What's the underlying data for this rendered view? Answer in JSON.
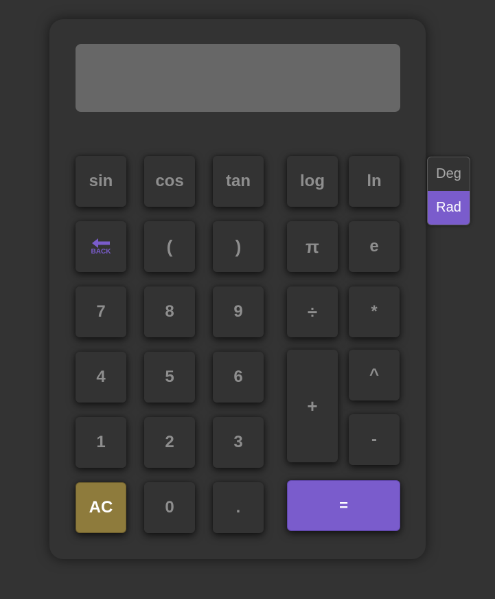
{
  "display": {
    "value": ""
  },
  "keys": {
    "sin": "sin",
    "cos": "cos",
    "tan": "tan",
    "log": "log",
    "ln": "ln",
    "back": "BACK",
    "lparen": "(",
    "rparen": ")",
    "pi": "π",
    "e": "e",
    "seven": "7",
    "eight": "8",
    "nine": "9",
    "divide": "÷",
    "multiply": "*",
    "four": "4",
    "five": "5",
    "six": "6",
    "plus": "+",
    "power": "^",
    "one": "1",
    "two": "2",
    "three": "3",
    "minus": "-",
    "clear": "AC",
    "zero": "0",
    "decimal": ".",
    "equals": "="
  },
  "angle_mode": {
    "options": [
      "Deg",
      "Rad"
    ],
    "selected": "Rad"
  },
  "colors": {
    "background": "#333333",
    "display": "#676767",
    "key_text": "#8e8e8e",
    "accent": "#7a5ccc",
    "clear_key": "#8e7b3c"
  },
  "icons": {
    "back": "back-arrow-icon"
  }
}
